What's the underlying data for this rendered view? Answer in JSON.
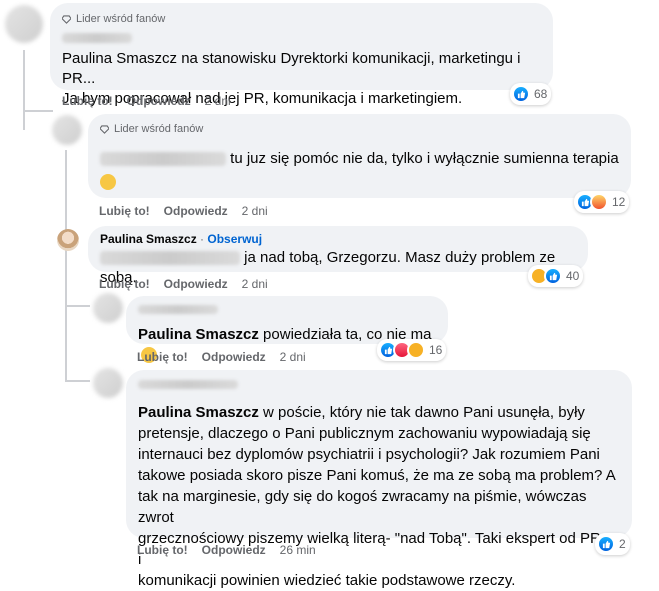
{
  "badge_label": "Lider wśród fanów",
  "comments": [
    {
      "text_full": "Paulina Smaszcz na stanowisku Dyrektorki komunikacji, marketingu i PR...",
      "text_line2": "Ja bym popracował nad jej PR, komunikacja i marketingiem.",
      "like": "Lubię to!",
      "reply": "Odpowiedz",
      "time": "2 dni",
      "reaction_count": "68"
    },
    {
      "text": "tu juz się pomóc nie da, tylko i wyłącznie sumienna terapia",
      "like": "Lubię to!",
      "reply": "Odpowiedz",
      "time": "2 dni",
      "reaction_count": "12"
    },
    {
      "author": "Paulina Smaszcz",
      "separator": " · ",
      "follow": "Obserwuj",
      "text": "ja nad tobą, Grzegorzu. Masz duży problem ze sobą.",
      "like": "Lubię to!",
      "reply": "Odpowiedz",
      "time": "2 dni",
      "reaction_count": "40"
    },
    {
      "mention": "Paulina Smaszcz",
      "text": " powiedziała ta, co nie ma",
      "like": "Lubię to!",
      "reply": "Odpowiedz",
      "time": "2 dni",
      "reaction_count": "16"
    },
    {
      "mention": "Paulina Smaszcz",
      "line1": " w poście, który nie tak dawno Pani usunęła, były",
      "line2": "pretensje, dlaczego o Pani publicznym zachowaniu wypowiadają się",
      "line3": "internauci bez dyplomów psychiatrii i psychologii? Jak rozumiem Pani",
      "line4": "takowe posiada skoro pisze Pani komuś, że ma ze sobą ma problem? A",
      "line5": "tak na marginesie, gdy się do kogoś zwracamy na piśmie, wówczas zwrot",
      "line6": "grzecznościowy piszemy wielką literą- \"nad Tobą\". Taki ekspert od PR-u i",
      "line7": "komunikacji powinien wiedzieć takie podstawowe rzeczy.",
      "like": "Lubię to!",
      "reply": "Odpowiedz",
      "time": "26 min",
      "reaction_count": "2"
    }
  ],
  "colors": {
    "bubble": "#f0f2f5",
    "meta": "#65676b",
    "link": "#0064d1",
    "like_blue": "#1877f2"
  }
}
